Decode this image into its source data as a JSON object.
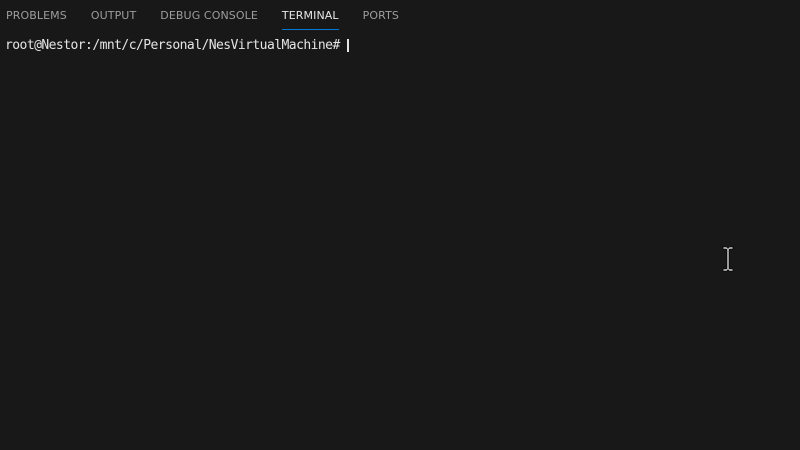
{
  "tabs": [
    {
      "label": "PROBLEMS",
      "active": false
    },
    {
      "label": "OUTPUT",
      "active": false
    },
    {
      "label": "DEBUG CONSOLE",
      "active": false
    },
    {
      "label": "TERMINAL",
      "active": true
    },
    {
      "label": "PORTS",
      "active": false
    }
  ],
  "terminal": {
    "prompt": "root@Nestor:/mnt/c/Personal/NesVirtualMachine#"
  },
  "colors": {
    "background": "#181818",
    "active_tab_underline": "#0078d4",
    "inactive_tab_text": "#9d9d9d",
    "active_tab_text": "#e7e7e7",
    "terminal_text": "#e5e5e5"
  },
  "icons": {
    "mouse_pointer": "text-cursor-ibeam-icon"
  }
}
